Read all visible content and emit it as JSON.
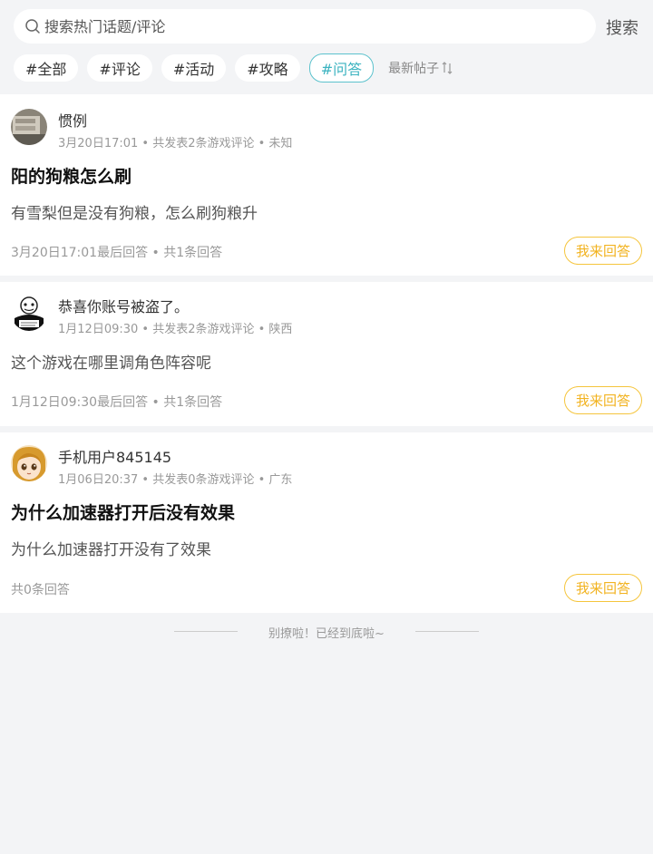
{
  "search": {
    "placeholder": "搜索热门话题/评论",
    "button_label": "搜索"
  },
  "tags": [
    {
      "label": "#全部"
    },
    {
      "label": "#评论"
    },
    {
      "label": "#活动"
    },
    {
      "label": "#攻略"
    },
    {
      "label": "#问答"
    }
  ],
  "sort_label": "最新帖子",
  "posts": [
    {
      "username": "惯例",
      "meta": "3月20日17:01 • 共发表2条游戏评论 • 未知",
      "title": "阳的狗粮怎么刷",
      "body": "有雪梨但是没有狗粮，怎么刷狗粮升",
      "footer": "3月20日17:01最后回答 • 共1条回答",
      "answer_label": "我来回答"
    },
    {
      "username": "恭喜你账号被盗了。",
      "meta": "1月12日09:30 • 共发表2条游戏评论 • 陕西",
      "title": "",
      "body": "这个游戏在哪里调角色阵容呢",
      "footer": "1月12日09:30最后回答 • 共1条回答",
      "answer_label": "我来回答"
    },
    {
      "username": "手机用户845145",
      "meta": "1月06日20:37 • 共发表0条游戏评论 • 广东",
      "title": "为什么加速器打开后没有效果",
      "body": "为什么加速器打开没有了效果",
      "footer": "共0条回答",
      "answer_label": "我来回答"
    }
  ],
  "end_text": "别撩啦！已经到底啦~",
  "colors": {
    "accent_teal": "#3bb3c0",
    "answer_yellow": "#f2b320",
    "background": "#f3f4f6"
  }
}
